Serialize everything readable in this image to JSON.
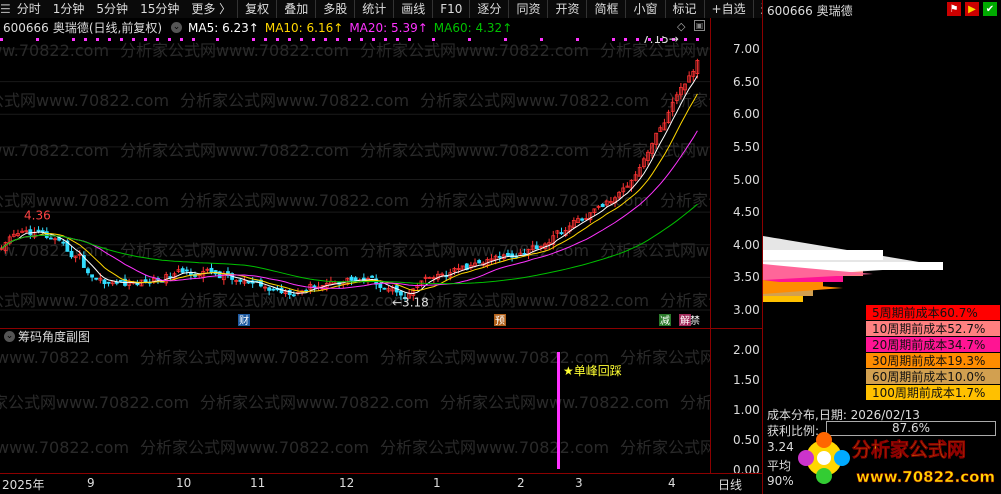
{
  "toolbar": {
    "items": [
      "分时",
      "1分钟",
      "5分钟",
      "15分钟",
      "更多 〉",
      "复权",
      "叠加",
      "多股",
      "统计",
      "画线",
      "F10",
      "逐分",
      "同资",
      "开资",
      "简框",
      "小窗",
      "标记",
      "+自选",
      "返回"
    ]
  },
  "stock": {
    "code": "600666",
    "name": "奥瑞德",
    "period_label": "(日线,前复权)"
  },
  "ma": {
    "ma5_label": "MA5: 6.23↑",
    "ma10_label": "MA10: 6.16↑",
    "ma20_label": "MA20: 5.39↑",
    "ma60_label": "MA60: 4.32↑"
  },
  "colors": {
    "ma5": "#ffffff",
    "ma10": "#ffd700",
    "ma20": "#ff33ff",
    "ma60": "#00c000",
    "up": "#ff3333",
    "down": "#33ddff",
    "accent_red": "#8b0000"
  },
  "main_chart": {
    "price_ticks": [
      "7.00",
      "6.50",
      "6.00",
      "5.50",
      "5.00",
      "4.50",
      "4.00",
      "3.50",
      "3.00"
    ],
    "high_label": "4.36",
    "low_label": "3.18",
    "peak_label": "7.15",
    "markers": [
      "财",
      "预",
      "减",
      "解禁"
    ],
    "watermark": "分析家公式网www.70822.com"
  },
  "sub_chart": {
    "title": "筹码角度副图",
    "ticks": [
      "2.00",
      "1.50",
      "1.00",
      "0.50",
      "0.00"
    ],
    "signal_text": "★单峰回踩",
    "signal_value": 1.95
  },
  "date_axis": {
    "labels": [
      "2025年",
      "9",
      "10",
      "11",
      "12",
      "1",
      "2",
      "3",
      "4"
    ],
    "period": "日线"
  },
  "right_panel": {
    "title": "600666 奥瑞德",
    "legend": [
      {
        "label": "5周期前成本60.7%",
        "color": "#ff0000"
      },
      {
        "label": "10周期前成本52.7%",
        "color": "#ff8080"
      },
      {
        "label": "20周期前成本34.7%",
        "color": "#ff1493"
      },
      {
        "label": "30周期前成本19.3%",
        "color": "#ff8c00"
      },
      {
        "label": "60周期前成本10.0%",
        "color": "#d2a050"
      },
      {
        "label": "100周期前成本1.7%",
        "color": "#ffc000"
      }
    ],
    "dist_label": "成本分布,日期: 2026/02/13",
    "profit_label": "获利比例:",
    "profit_value": "87.6%",
    "row3": "3.24",
    "row4": "平均",
    "row5": "90%"
  },
  "logo": {
    "name": "分析家公式网",
    "url": "www.70822.com"
  }
}
